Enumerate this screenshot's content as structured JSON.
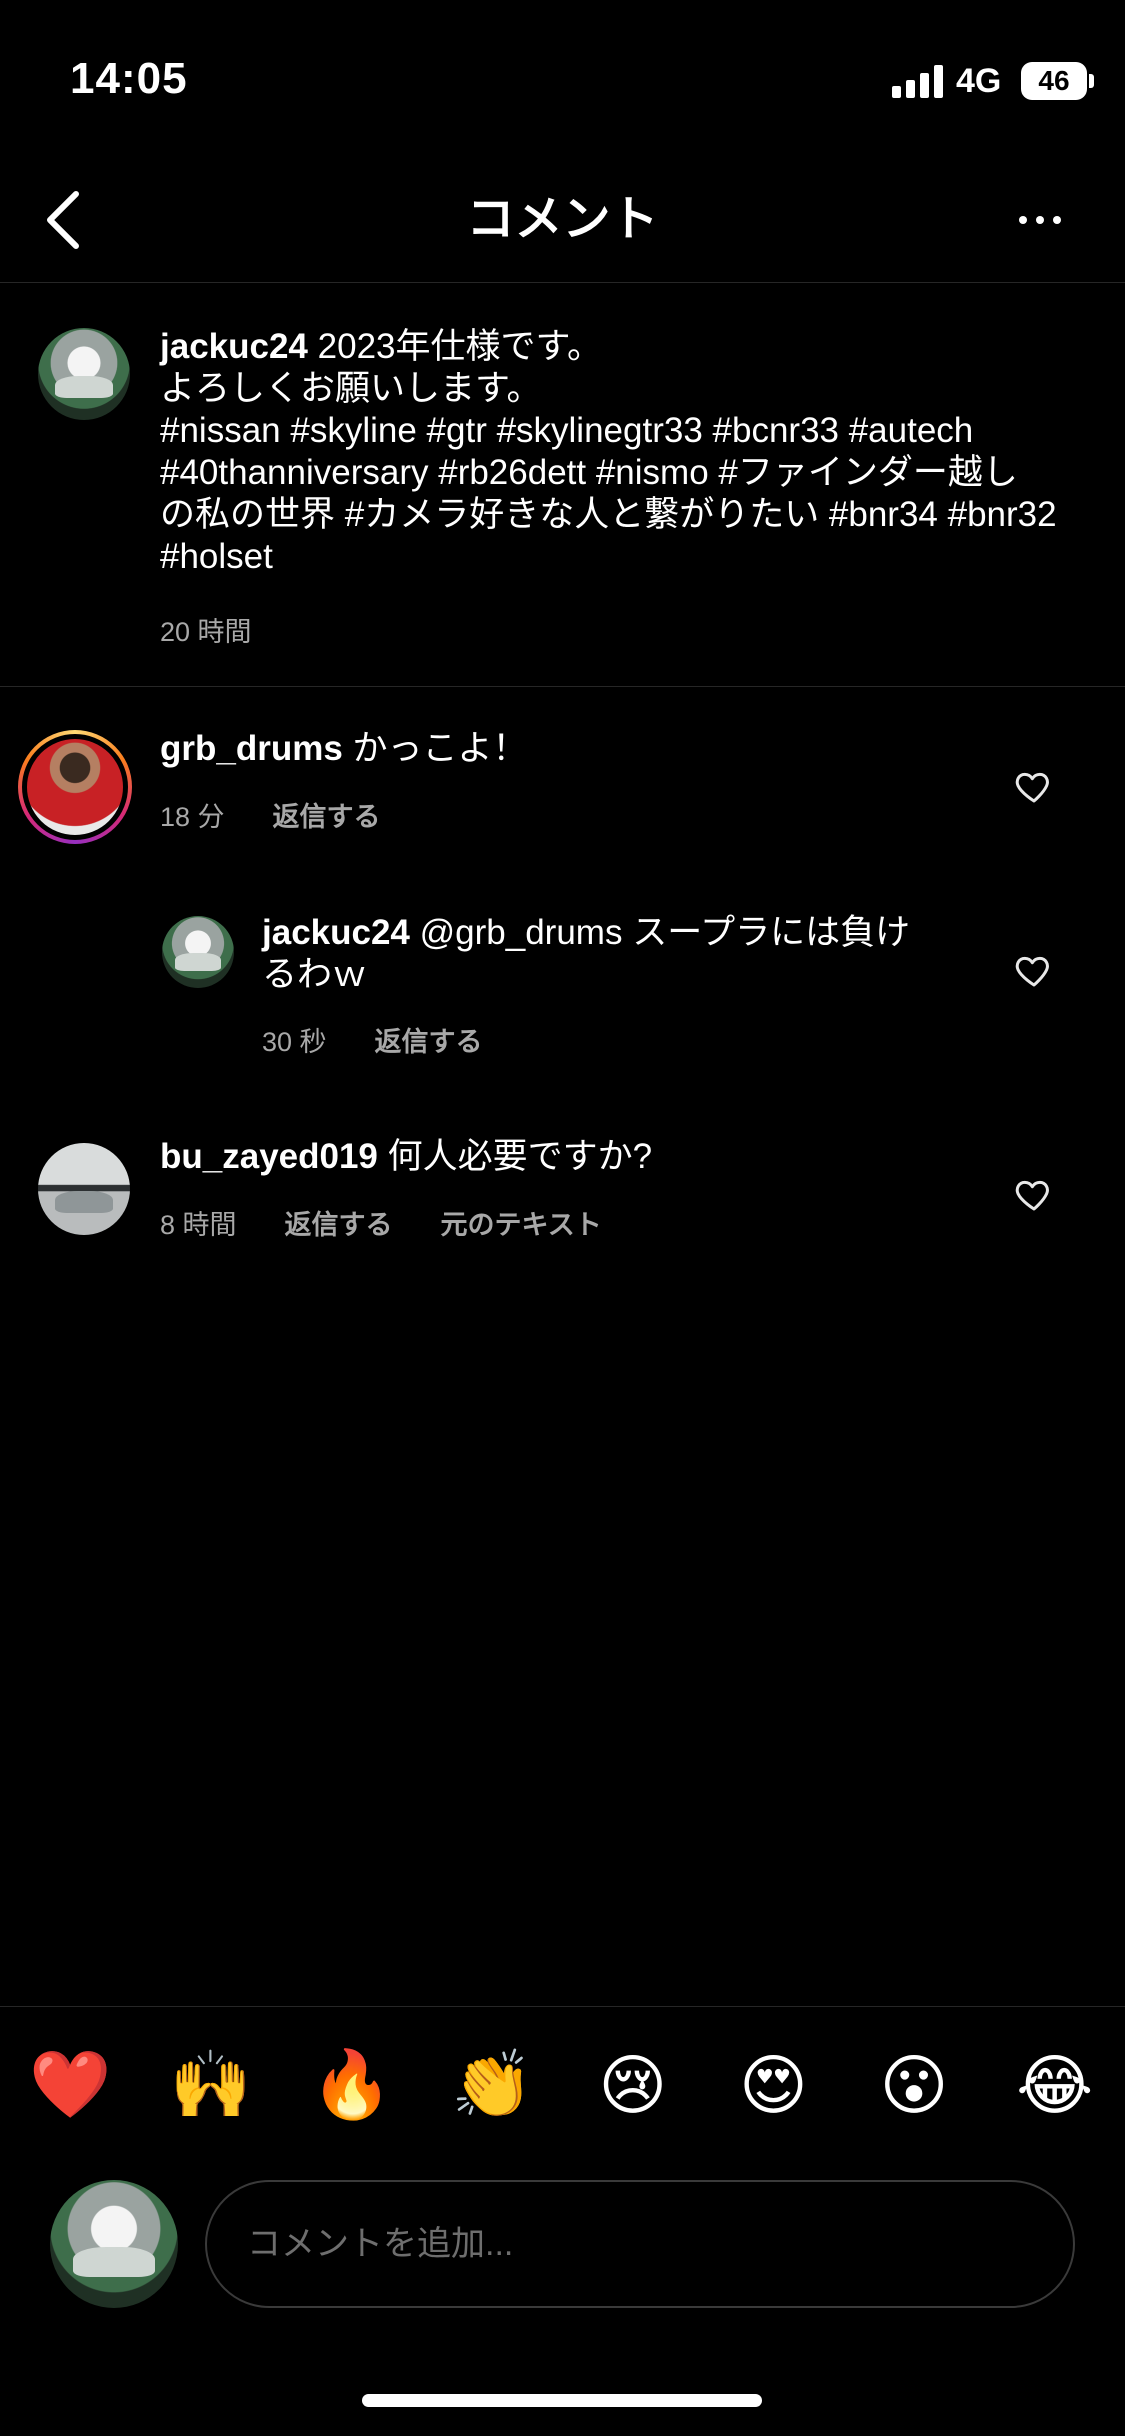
{
  "status_bar": {
    "time": "14:05",
    "network": "4G",
    "battery": "46"
  },
  "header": {
    "title": "コメント"
  },
  "post": {
    "username": "jackuc24",
    "caption_line1": "2023年仕様です。",
    "caption_line2": "よろしくお願いします。",
    "hashtags_line1": "#nissan #skyline #gtr #skylinegtr33 #bcnr33 #autech",
    "hashtags_line2": "#40thanniversary #rb26dett #nismo #ファインダー越し",
    "hashtags_line3": "の私の世界 #カメラ好きな人と繋がりたい #bnr34 #bnr32",
    "hashtags_line4": "#holset",
    "time": "20 時間"
  },
  "comments": [
    {
      "username": "grb_drums",
      "text": "かっこよ！",
      "time": "18 分",
      "reply_label": "返信する"
    },
    {
      "username": "jackuc24",
      "mention": "@grb_drums",
      "text_line1": "スープラには負け",
      "text_line2": "るわｗ",
      "time": "30 秒",
      "reply_label": "返信する"
    },
    {
      "username": "bu_zayed019",
      "text": "何人必要ですか?",
      "time": "8 時間",
      "reply_label": "返信する",
      "original_text_label": "元のテキスト"
    }
  ],
  "emoji_bar": [
    "❤️",
    "🙌",
    "🔥",
    "👏",
    "😢",
    "😍",
    "😮",
    "😂"
  ],
  "composer": {
    "placeholder": "コメントを追加..."
  },
  "icons": {
    "back": "chevron-left-icon",
    "more": "more-horizontal-icon",
    "like": "heart-outline-icon"
  }
}
